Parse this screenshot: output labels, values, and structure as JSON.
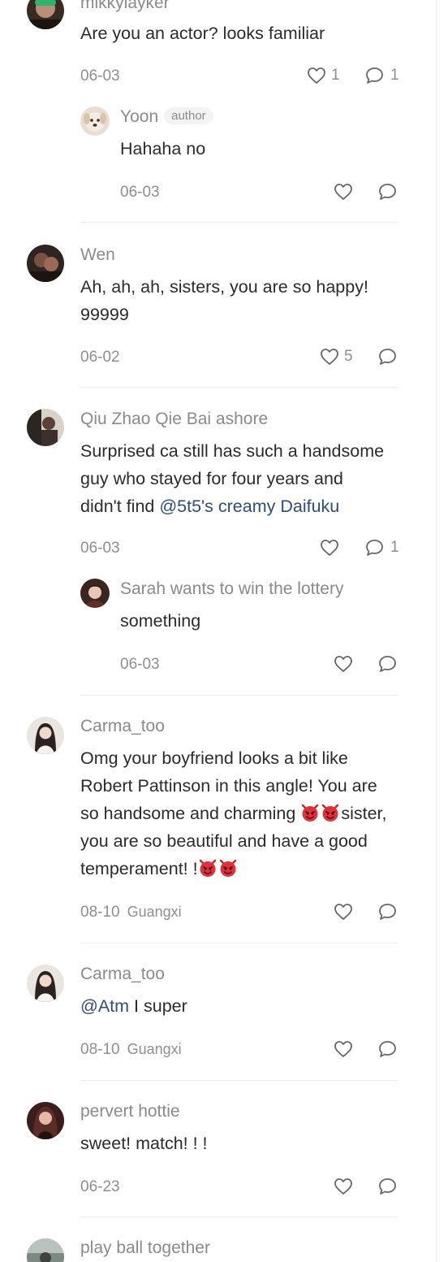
{
  "comments": [
    {
      "name": "mikkylayker",
      "text": "Are you an actor? looks familiar",
      "date": "06-03",
      "likes": "1",
      "replies": "1"
    },
    {
      "name": "Yoon",
      "author_tag": "author",
      "text": "Hahaha no",
      "date": "06-03"
    },
    {
      "name": "Wen",
      "text_line1": "Ah, ah, ah, sisters, you are so happy!",
      "text_line2": "99999",
      "date": "06-02",
      "likes": "5"
    },
    {
      "name": "Qiu Zhao Qie Bai ashore",
      "text_line1": "Surprised ca still has such a handsome",
      "text_line2": "guy who stayed for four years and",
      "text_line3_prefix": "didn't find ",
      "text_line3_mention": "@5t5's creamy Daifuku",
      "date": "06-03",
      "replies": "1"
    },
    {
      "name": "Sarah wants to win the lottery",
      "text": "something",
      "date": "06-03"
    },
    {
      "name": "Carma_too",
      "text_line1": "Omg your boyfriend looks a bit like",
      "text_line2": "Robert Pattinson in this angle! You are",
      "text_line3_prefix": "so handsome and charming ",
      "text_line3_suffix": "sister,",
      "text_line4": "you are so beautiful and have a good",
      "text_line5_prefix": "temperament! !",
      "date": "08-10",
      "location": "Guangxi"
    },
    {
      "name": "Carma_too",
      "mention": "@Atm",
      "text": " I super",
      "date": "08-10",
      "location": "Guangxi"
    },
    {
      "name": "pervert hottie",
      "text": "sweet! match! ! !",
      "date": "06-23"
    },
    {
      "name": "play ball together"
    }
  ],
  "icons": {
    "like": "heart-outline-icon",
    "reply": "speech-bubble-outline-icon",
    "emoji": "devil-face-emoji"
  },
  "colors": {
    "mention": "#2f4c7b",
    "meta": "#8e8e8e",
    "emoji": "#e0303a"
  }
}
